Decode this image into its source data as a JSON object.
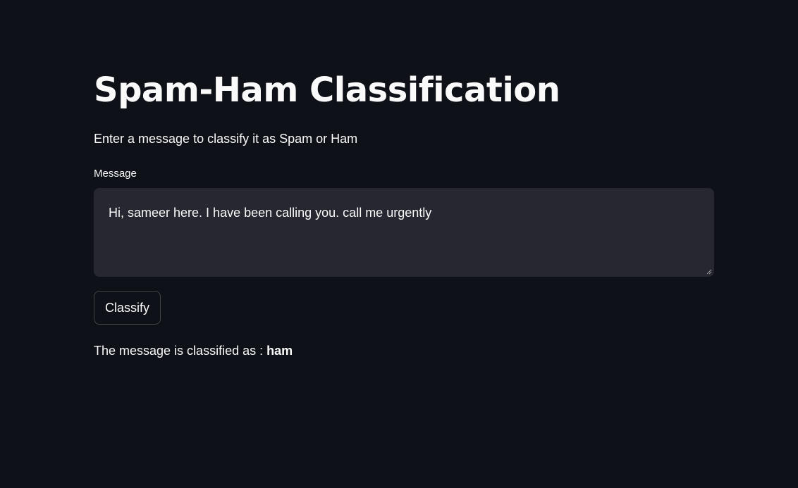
{
  "header": {
    "title": "Spam-Ham Classification",
    "subtitle": "Enter a message to classify it as Spam or Ham"
  },
  "form": {
    "message_label": "Message",
    "message_value": "Hi, sameer here. I have been calling you. call me urgently",
    "classify_label": "Classify"
  },
  "result": {
    "prefix": "The message is classified as : ",
    "value": "ham"
  },
  "theme": {
    "background": "#0e1117",
    "input_background": "#262730",
    "text": "#fafafa"
  }
}
